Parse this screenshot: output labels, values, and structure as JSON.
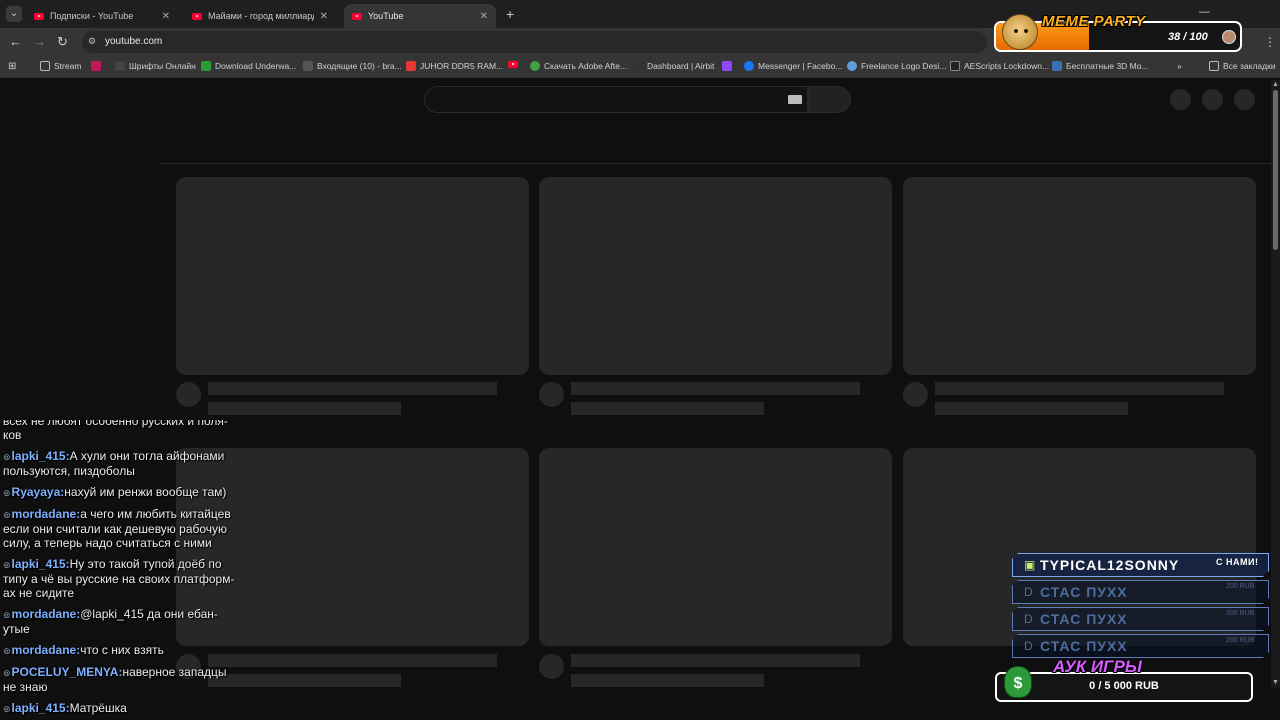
{
  "browser": {
    "tabs": [
      {
        "title": "Подписки - YouTube",
        "active": false
      },
      {
        "title": "Майами - город миллиардеров",
        "active": false
      },
      {
        "title": "YouTube",
        "active": true
      }
    ],
    "url": "youtube.com",
    "bookmarks": [
      "Stream",
      "Шрифты Онлайн",
      "Download Underwa...",
      "Входящие (10) - bra...",
      "JUHOR DDR5 RAM...",
      "Скачать Adobe Afte...",
      "Dashboard | Airbit",
      "Messenger | Facebo...",
      "Freelance Logo Desi...",
      "AEScripts Lockdown...",
      "Бесплатные 3D Mo...",
      "Все закладки"
    ],
    "icons": {
      "tab_dropdown": "chevron-down-icon",
      "new_tab": "plus-icon",
      "back": "arrow-left-icon",
      "forward": "arrow-right-icon",
      "reload": "reload-icon",
      "site_info": "tune-icon",
      "more": "kebab-icon",
      "apps": "grid-icon"
    }
  },
  "chat": {
    "messages": [
      {
        "user": "",
        "text": "всех не любят особенно русских и поля-ков"
      },
      {
        "user": "lapki_415:",
        "text": "А хули они тогла айфонами пользуются, пиздоболы"
      },
      {
        "user": "Ryayaya:",
        "text": "нахуй им ренжи вообще там)"
      },
      {
        "user": "mordadane:",
        "text": "а чего им любить китайцев если они считали как дешевую рабочую силу, а теперь надо считаться с ними"
      },
      {
        "user": "lapki_415:",
        "text": "Ну это такой тупой доёб по типу а чё вы русские на своих платформ-ах не сидите"
      },
      {
        "user": "mordadane:",
        "text": "@lapki_415 да они ебан-утые"
      },
      {
        "user": "mordadane:",
        "text": "что с них взять"
      },
      {
        "user": "POCELUY_MENYA:",
        "text": "наверное западцы не знаю"
      },
      {
        "user": "lapki_415:",
        "text": "Матрёшка"
      }
    ]
  },
  "meme_party": {
    "title": "MEME PARTY",
    "count": "38 / 100",
    "progress": 0.38
  },
  "donations": {
    "with_us_label": "С НАМИ!",
    "items": [
      {
        "name": "TYPICAL12SONNY",
        "amount": ""
      },
      {
        "name": "СТАС ПУХХ",
        "amount": "200 RUB"
      },
      {
        "name": "СТАС ПУХХ",
        "amount": "200 RUB"
      },
      {
        "name": "СТАС ПУХХ",
        "amount": "200 RUB"
      }
    ]
  },
  "auction": {
    "title": "АУК ИГРЫ",
    "value": "0 / 5 000 RUB",
    "progress": 0
  },
  "colors": {
    "page_bg": "#0f0f0f",
    "skeleton": "#272727",
    "chat_username": "#7fb0ff",
    "meme_accent": "#ffb020",
    "auction_accent": "#d65cff"
  }
}
